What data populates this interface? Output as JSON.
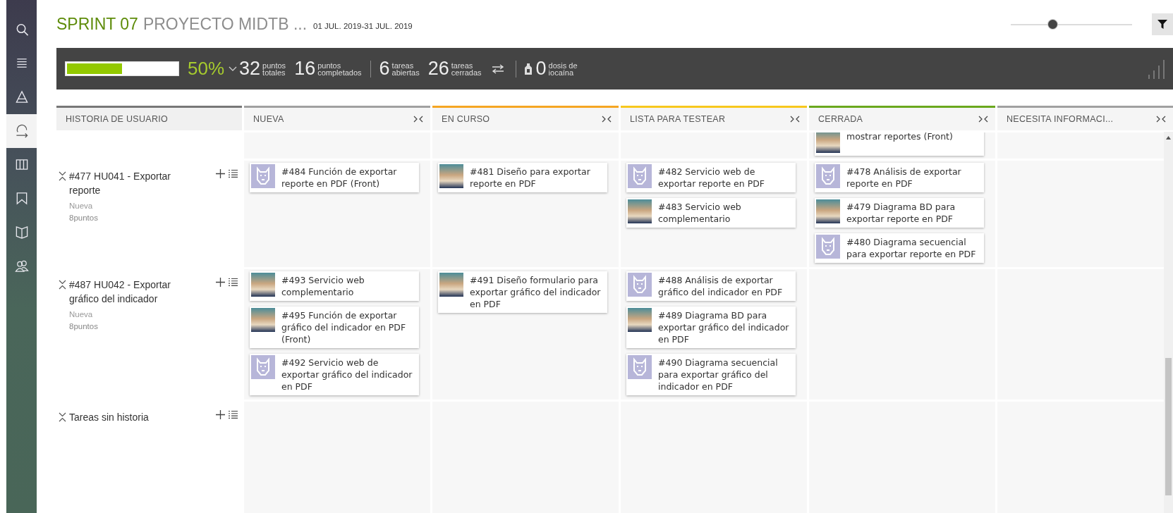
{
  "sidebar": {
    "items": [
      {
        "selected": false
      },
      {
        "selected": false
      },
      {
        "selected": false
      },
      {
        "selected": true
      },
      {
        "selected": false
      },
      {
        "selected": false
      },
      {
        "selected": false
      },
      {
        "selected": false
      }
    ]
  },
  "header": {
    "sprint": "SPRINT 07",
    "project": "PROYECTO MIDTB ...",
    "dates": "01 JUL. 2019-31 JUL. 2019",
    "zoom_slider": {
      "level": 0.35
    }
  },
  "stats": {
    "progress": {
      "level": 0.5
    },
    "percent": "50%",
    "items": [
      {
        "kind": "stat",
        "value": "32",
        "lines": [
          "puntos",
          "totales"
        ]
      },
      {
        "kind": "stat",
        "value": "16",
        "lines": [
          "puntos",
          "completados"
        ]
      },
      {
        "kind": "divider"
      },
      {
        "kind": "stat",
        "value": "6",
        "lines": [
          "tareas",
          "abiertas"
        ]
      },
      {
        "kind": "stat",
        "value": "26",
        "lines": [
          "tareas",
          "cerradas"
        ]
      },
      {
        "kind": "swap"
      },
      {
        "kind": "divider"
      },
      {
        "kind": "iocaine",
        "value": "0",
        "lines": [
          "dosis de",
          "iocaína"
        ]
      }
    ]
  },
  "board": {
    "story_header": "HISTORIA DE USUARIO",
    "columns": [
      {
        "name": "NUEVA",
        "color": "#a0a0a0"
      },
      {
        "name": "EN CURSO",
        "color": "#f5a623"
      },
      {
        "name": "LISTA PARA TESTEAR",
        "color": "#f7c81e"
      },
      {
        "name": "CERRADA",
        "color": "#6aa81e"
      },
      {
        "name": "NECESITA INFORMACI...",
        "color": "#a0a0a0"
      }
    ],
    "partial_row": {
      "cells": [
        [],
        [],
        [],
        [
          {
            "text": "mostrar reportes (Front)",
            "kind": "photo"
          }
        ],
        []
      ]
    },
    "rows": [
      {
        "title": "#477 HU041 - Exportar reporte",
        "status": "Nueva",
        "points": "8puntos",
        "cells": [
          [
            {
              "text": "#484 Función de exportar reporte en PDF (Front)",
              "kind": "pixel"
            }
          ],
          [
            {
              "text": "#481 Diseño para exportar reporte en PDF",
              "kind": "photo"
            }
          ],
          [
            {
              "text": "#482 Servicio web de exportar reporte en PDF",
              "kind": "pixel"
            },
            {
              "text": "#483 Servicio web complementario",
              "kind": "photo"
            }
          ],
          [
            {
              "text": "#478 Análisis de exportar reporte en PDF",
              "kind": "pixel"
            },
            {
              "text": "#479 Diagrama BD para exportar reporte en PDF",
              "kind": "photo"
            },
            {
              "text": "#480 Diagrama secuencial para exportar reporte en PDF",
              "kind": "pixel"
            }
          ],
          []
        ]
      },
      {
        "title": "#487 HU042 - Exportar gráfico del indicador",
        "status": "Nueva",
        "points": "8puntos",
        "cells": [
          [
            {
              "text": "#493 Servicio web complementario",
              "kind": "photo"
            },
            {
              "text": "#495 Función de exportar gráfico del indicador en PDF (Front)",
              "kind": "photo"
            },
            {
              "text": "#492 Servicio web de exportar gráfico del indicador en PDF",
              "kind": "pixel"
            }
          ],
          [
            {
              "text": "#491 Diseño formulario para exportar gráfico del indicador en PDF",
              "kind": "photo"
            }
          ],
          [
            {
              "text": "#488 Análisis de exportar gráfico del indicador en PDF",
              "kind": "pixel"
            },
            {
              "text": "#489 Diagrama BD para exportar gráfico del indicador en PDF",
              "kind": "photo"
            },
            {
              "text": "#490 Diagrama secuencial para exportar gráfico del indicador en PDF",
              "kind": "pixel"
            }
          ],
          [],
          []
        ]
      },
      {
        "title": "Tareas sin historia",
        "cells": [
          [],
          [],
          [],
          [],
          []
        ]
      }
    ]
  }
}
